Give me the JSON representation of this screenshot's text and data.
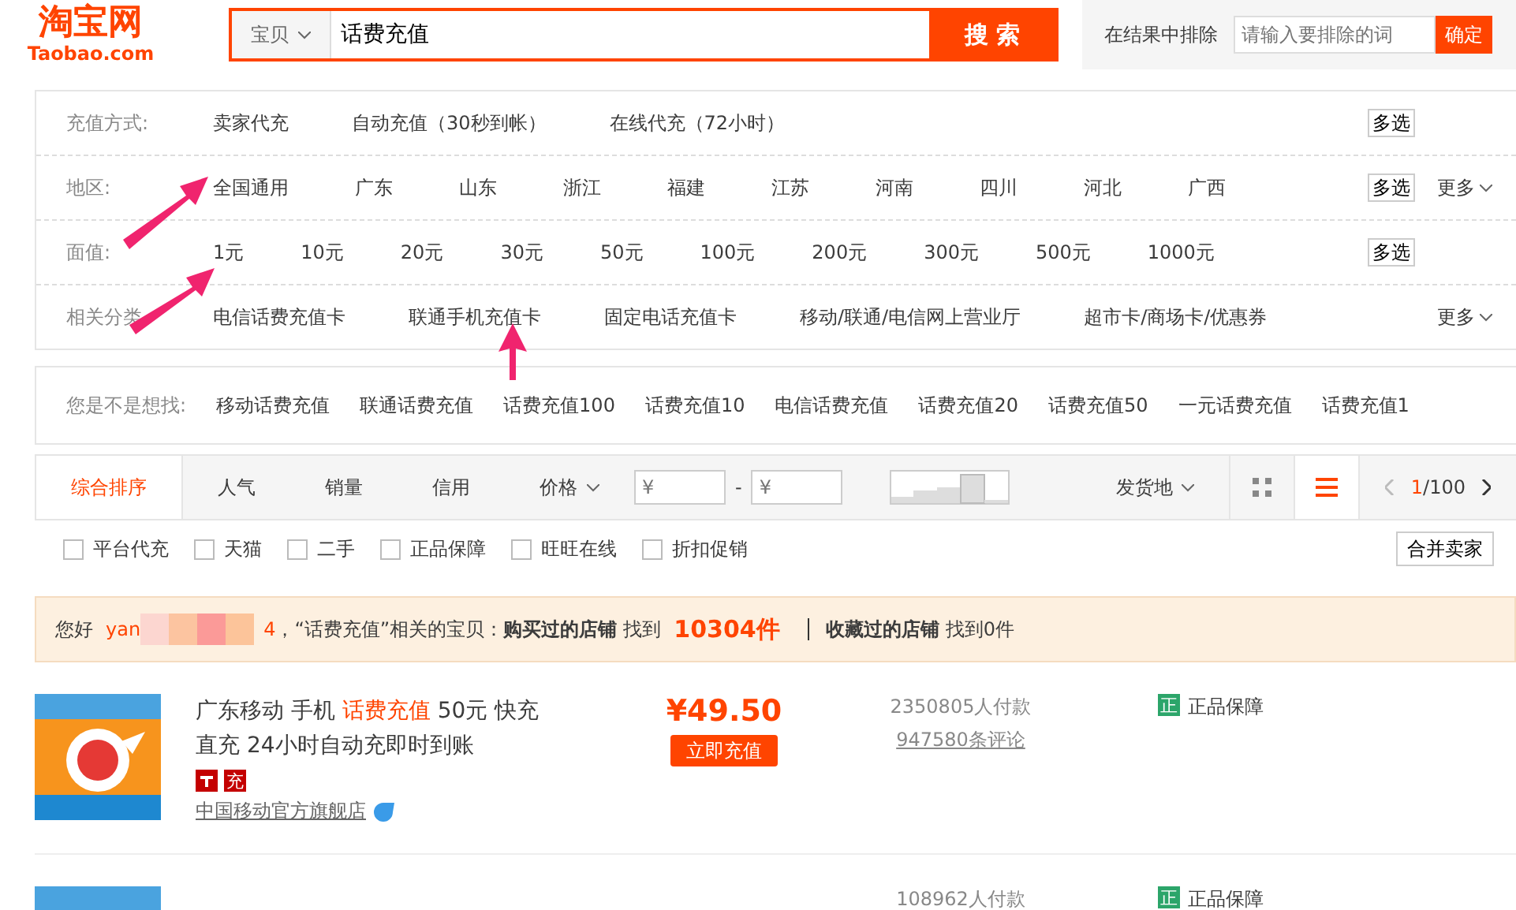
{
  "header": {
    "logo": "淘宝网",
    "logo_sub": "Taobao.com",
    "scope": "宝贝",
    "query": "话费充值",
    "search_button": "搜 索",
    "exclude_label": "在结果中排除",
    "exclude_placeholder": "请输入要排除的词",
    "exclude_button": "确定"
  },
  "filters": [
    {
      "label": "充值方式:",
      "items": [
        "卖家代充",
        "自动充值（30秒到帐）",
        "在线代充（72小时）"
      ],
      "multi": "多选"
    },
    {
      "label": "地区:",
      "items": [
        "全国通用",
        "广东",
        "山东",
        "浙江",
        "福建",
        "江苏",
        "河南",
        "四川",
        "河北",
        "广西"
      ],
      "multi": "多选",
      "more": "更多"
    },
    {
      "label": "面值:",
      "items": [
        "1元",
        "10元",
        "20元",
        "30元",
        "50元",
        "100元",
        "200元",
        "300元",
        "500元",
        "1000元"
      ],
      "multi": "多选"
    },
    {
      "label": "相关分类",
      "items": [
        "电信话费充值卡",
        "联通手机充值卡",
        "固定电话充值卡",
        "移动/联通/电信网上营业厅",
        "超市卡/商场卡/优惠券"
      ],
      "more": "更多"
    }
  ],
  "suggest": {
    "label": "您是不是想找:",
    "items": [
      "移动话费充值",
      "联通话费充值",
      "话费充值100",
      "话费充值10",
      "电信话费充值",
      "话费充值20",
      "话费充值50",
      "一元话费充值",
      "话费充值1"
    ]
  },
  "sort": {
    "tabs": [
      {
        "label": "综合排序",
        "selected": true
      },
      {
        "label": "人气",
        "selected": false
      },
      {
        "label": "销量",
        "selected": false
      },
      {
        "label": "信用",
        "selected": false
      }
    ],
    "price": "价格",
    "min_placeholder": "¥",
    "dash": "-",
    "max_placeholder": "¥",
    "ship": "发货地",
    "page_current": "1",
    "page_total": "/100"
  },
  "checks": [
    {
      "label": "平台代充",
      "checked": false
    },
    {
      "label": "天猫",
      "checked": false
    },
    {
      "label": "二手",
      "checked": false
    },
    {
      "label": "正品保障",
      "checked": false
    },
    {
      "label": "旺旺在线",
      "checked": false
    },
    {
      "label": "折扣促销",
      "checked": false
    }
  ],
  "merge_button": "合并卖家",
  "greeting": {
    "hello": "您好",
    "user_start": "yan",
    "user_end": "4",
    "text": "，“话费充值”相关的宝贝：",
    "bought": "购买过的店铺",
    "found": "找到",
    "count": "10304件",
    "fav": "收藏过的店铺",
    "fav_found": "找到0件"
  },
  "products": [
    {
      "title_parts": [
        "广东移动 手机 ",
        "话费充值",
        " 50元 快充直充 24小时自动充即时到账"
      ],
      "price": "¥49.50",
      "action": "立即充值",
      "paid": "2350805人付款",
      "reviews": "947580条评论",
      "badge": "充",
      "shop": "中国移动官方旗舰店",
      "guarantee": "正品保障",
      "guarantee_icon": "正"
    },
    {
      "paid": "108962人付款",
      "guarantee": "正品保障",
      "guarantee_icon": "正"
    }
  ]
}
